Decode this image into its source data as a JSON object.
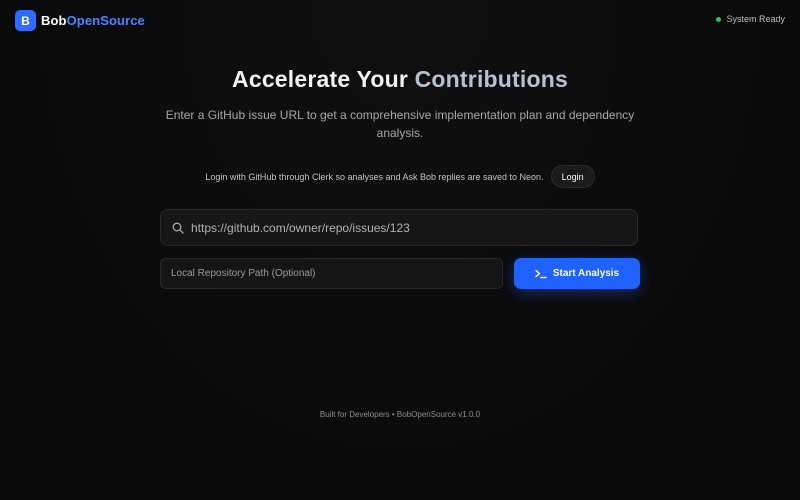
{
  "header": {
    "logo_letter": "B",
    "brand_part1": "Bob",
    "brand_part2": "OpenSource",
    "status_text": "System Ready"
  },
  "hero": {
    "title_part1": "Accelerate Your ",
    "title_part2": "Contributions",
    "subtitle": "Enter a GitHub issue URL to get a comprehensive implementation plan and dependency analysis."
  },
  "auth": {
    "message": "Login with GitHub through Clerk so analyses and Ask Bob replies are saved to Neon.",
    "login_label": "Login"
  },
  "form": {
    "issue_url_value": "https://github.com/owner/repo/issues/123",
    "local_path_placeholder": "Local Repository Path (Optional)",
    "start_label": "Start Analysis"
  },
  "footer": {
    "text": "Built for Developers • BobOpenSource v1.0.0"
  },
  "colors": {
    "accent": "#1f62ff",
    "brand_blue": "#4c84ff",
    "status_green": "#22c55e",
    "background": "#0b0b0c"
  },
  "icons": {
    "search": "search-icon",
    "terminal": "terminal-icon"
  }
}
